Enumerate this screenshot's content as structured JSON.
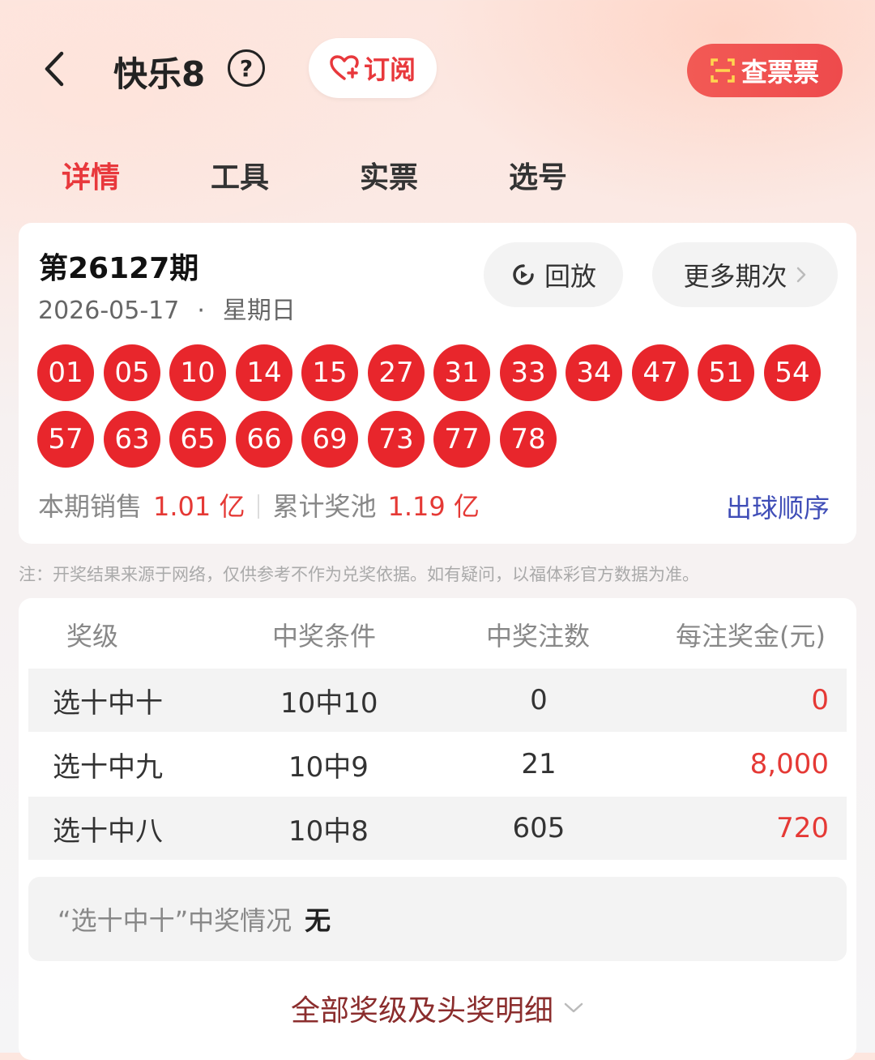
{
  "header": {
    "title": "快乐8",
    "help_label": "?",
    "subscribe_label": "订阅",
    "check_ticket_label": "查票票"
  },
  "tabs": [
    {
      "label": "详情",
      "active": true
    },
    {
      "label": "工具",
      "active": false
    },
    {
      "label": "实票",
      "active": false
    },
    {
      "label": "选号",
      "active": false
    }
  ],
  "draw": {
    "period": "第26127期",
    "date": "2026-05-17",
    "separator": "·",
    "weekday": "星期日",
    "replay_label": "回放",
    "more_label": "更多期次",
    "balls": [
      "01",
      "05",
      "10",
      "14",
      "15",
      "27",
      "31",
      "33",
      "34",
      "47",
      "51",
      "54",
      "57",
      "63",
      "65",
      "66",
      "69",
      "73",
      "77",
      "78"
    ],
    "sales_label": "本期销售",
    "sales_value": "1.01 亿",
    "pool_label": "累计奖池",
    "pool_value": "1.19 亿",
    "ball_order_label": "出球顺序"
  },
  "note": "注：开奖结果来源于网络，仅供参考不作为兑奖依据。如有疑问，以福体彩官方数据为准。",
  "prize_table": {
    "headers": [
      "奖级",
      "中奖条件",
      "中奖注数",
      "每注奖金(元)"
    ],
    "rows": [
      {
        "level": "选十中十",
        "condition": "10中10",
        "count": "0",
        "prize": "0"
      },
      {
        "level": "选十中九",
        "condition": "10中9",
        "count": "21",
        "prize": "8,000"
      },
      {
        "level": "选十中八",
        "condition": "10中8",
        "count": "605",
        "prize": "720"
      }
    ],
    "summary_question": "“选十中十”中奖情况",
    "summary_answer": "无",
    "all_levels_label": "全部奖级及头奖明细"
  },
  "colors": {
    "accent": "#e8383c",
    "ball": "#e8262c",
    "link": "#3f4db7"
  }
}
